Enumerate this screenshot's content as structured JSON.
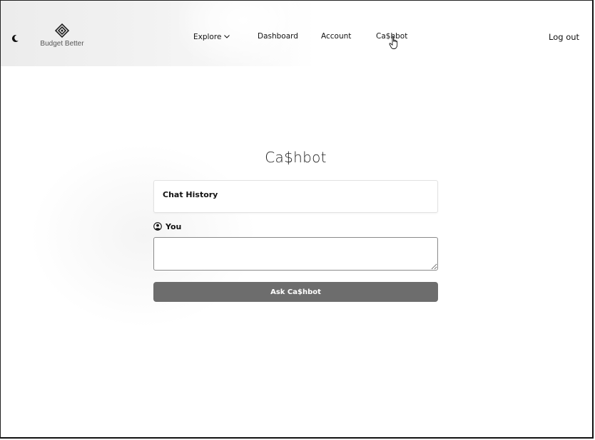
{
  "header": {
    "theme_toggle_icon": "moon-icon",
    "logo_icon": "diamond-logo-icon",
    "logo_text": "Budget Better",
    "nav": {
      "explore": "Explore",
      "explore_icon": "chevron-down-icon",
      "dashboard": "Dashboard",
      "account": "Account",
      "cashbot": "Ca$hbot"
    },
    "logout": "Log out"
  },
  "main": {
    "title": "Ca$hbot",
    "chat_history_title": "Chat History",
    "you_label": "You",
    "you_icon": "user-circle-icon",
    "prompt_value": "",
    "prompt_placeholder": "",
    "ask_button_label": "Ask Ca$hbot"
  },
  "colors": {
    "button_bg": "#6d6d6d",
    "button_text": "#ffffff",
    "text": "#111111"
  }
}
